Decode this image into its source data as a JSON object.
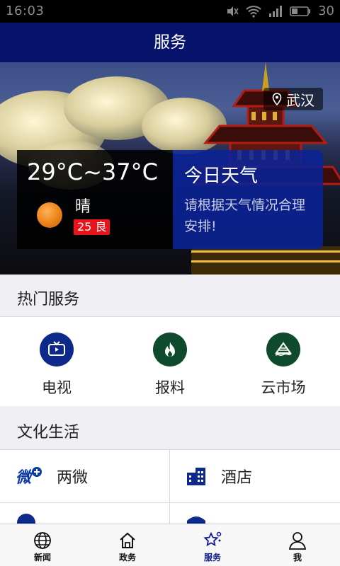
{
  "status_bar": {
    "time": "16:03",
    "battery": "30"
  },
  "header": {
    "title": "服务"
  },
  "weather": {
    "location": "武汉",
    "temperature": "29°C~37°C",
    "condition": "晴",
    "aqi": "25 良",
    "title": "今日天气",
    "tip": "请根据天气情况合理安排!"
  },
  "hot_services": {
    "title": "热门服务",
    "items": [
      {
        "label": "电视",
        "icon": "tv-icon",
        "color": "#0d2a8a"
      },
      {
        "label": "报料",
        "icon": "fire-icon",
        "color": "#0f4a2c"
      },
      {
        "label": "云市场",
        "icon": "market-icon",
        "color": "#0f4a2c"
      }
    ]
  },
  "culture": {
    "title": "文化生活",
    "items": [
      {
        "label": "两微",
        "icon": "weibo-icon"
      },
      {
        "label": "酒店",
        "icon": "hotel-icon"
      }
    ]
  },
  "tabs": [
    {
      "label": "新闻",
      "icon": "globe-icon"
    },
    {
      "label": "政务",
      "icon": "home-icon"
    },
    {
      "label": "服务",
      "icon": "star-icon",
      "active": true
    },
    {
      "label": "我",
      "icon": "user-icon"
    }
  ],
  "colors": {
    "nav": "#07126b",
    "accent": "#0b1b8f",
    "weather_card": "#0a2296",
    "aqi": "#e8141b"
  }
}
